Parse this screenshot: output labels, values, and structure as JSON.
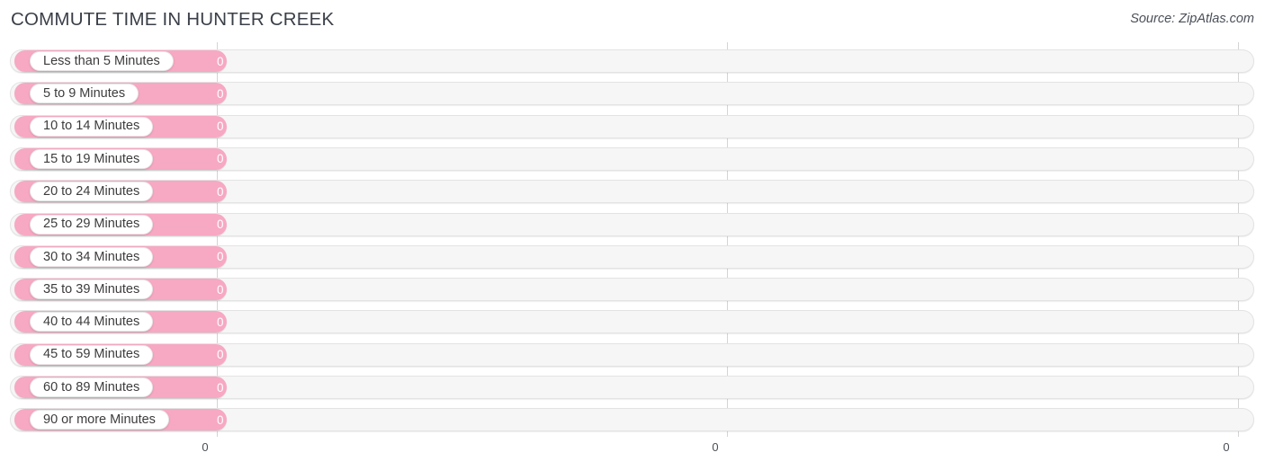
{
  "header": {
    "title": "COMMUTE TIME IN HUNTER CREEK",
    "source": "Source: ZipAtlas.com"
  },
  "colors": {
    "bar": "#f7a8c2",
    "track": "#f6f6f6",
    "track_border": "#e3e3e3",
    "gridline": "#d4d4d4",
    "title_text": "#3a3f48",
    "label_text": "#3c3c3c",
    "value_text": "#ffffff"
  },
  "chart_data": {
    "type": "bar",
    "orientation": "horizontal",
    "title": "COMMUTE TIME IN HUNTER CREEK",
    "xlabel": "",
    "ylabel": "",
    "grid": true,
    "legend": null,
    "xlim": [
      0,
      0
    ],
    "xticks": [
      "0",
      "0",
      "0"
    ],
    "categories": [
      "Less than 5 Minutes",
      "5 to 9 Minutes",
      "10 to 14 Minutes",
      "15 to 19 Minutes",
      "20 to 24 Minutes",
      "25 to 29 Minutes",
      "30 to 34 Minutes",
      "35 to 39 Minutes",
      "40 to 44 Minutes",
      "45 to 59 Minutes",
      "60 to 89 Minutes",
      "90 or more Minutes"
    ],
    "values": [
      0,
      0,
      0,
      0,
      0,
      0,
      0,
      0,
      0,
      0,
      0,
      0
    ],
    "value_labels": [
      "0",
      "0",
      "0",
      "0",
      "0",
      "0",
      "0",
      "0",
      "0",
      "0",
      "0",
      "0"
    ]
  }
}
